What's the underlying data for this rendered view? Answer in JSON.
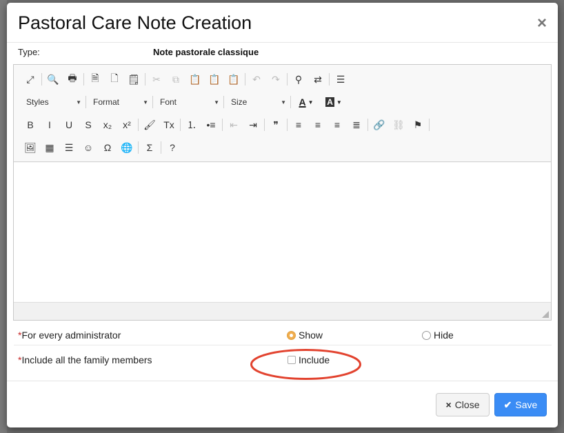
{
  "modal": {
    "title": "Pastoral Care Note Creation",
    "close_glyph": "×"
  },
  "type_row": {
    "label": "Type:",
    "value": "Note pastorale classique"
  },
  "editor": {
    "toolbar": {
      "row1": [
        {
          "icon": "maximize-icon",
          "glyph": "⤢"
        },
        {
          "sep": true
        },
        {
          "icon": "preview-icon",
          "glyph": "🔍"
        },
        {
          "icon": "print-icon",
          "glyph": "🖶"
        },
        {
          "sep": true
        },
        {
          "icon": "templates-icon",
          "glyph": "🗎"
        },
        {
          "icon": "new-page-icon",
          "glyph": "🗋"
        },
        {
          "icon": "source-icon",
          "glyph": "🗒"
        },
        {
          "sep": true
        },
        {
          "icon": "cut-icon",
          "glyph": "✂",
          "disabled": true
        },
        {
          "icon": "copy-icon",
          "glyph": "⧉",
          "disabled": true
        },
        {
          "icon": "paste-icon",
          "glyph": "📋"
        },
        {
          "icon": "paste-text-icon",
          "glyph": "📋"
        },
        {
          "icon": "paste-word-icon",
          "glyph": "📋"
        },
        {
          "sep": true
        },
        {
          "icon": "undo-icon",
          "glyph": "↶",
          "disabled": true
        },
        {
          "icon": "redo-icon",
          "glyph": "↷",
          "disabled": true
        },
        {
          "sep": true
        },
        {
          "icon": "find-icon",
          "glyph": "⚲"
        },
        {
          "icon": "replace-icon",
          "glyph": "⇄"
        },
        {
          "sep": true
        },
        {
          "icon": "select-all-icon",
          "glyph": "☰"
        }
      ],
      "combos": [
        {
          "label": "Styles",
          "width": 92
        },
        {
          "label": "Format",
          "width": 92
        },
        {
          "label": "Font",
          "width": 98
        },
        {
          "label": "Size",
          "width": 92
        }
      ],
      "text_color_glyph": "A",
      "bg_color_glyph": "A",
      "row3": [
        {
          "icon": "bold-icon",
          "glyph": "B"
        },
        {
          "icon": "italic-icon",
          "glyph": "I"
        },
        {
          "icon": "underline-icon",
          "glyph": "U"
        },
        {
          "icon": "strike-icon",
          "glyph": "S"
        },
        {
          "icon": "subscript-icon",
          "glyph": "x₂"
        },
        {
          "icon": "superscript-icon",
          "glyph": "x²"
        },
        {
          "sep": true
        },
        {
          "icon": "copy-format-icon",
          "glyph": "🖌"
        },
        {
          "icon": "remove-format-icon",
          "glyph": "Tx"
        },
        {
          "sep": true
        },
        {
          "icon": "numbered-list-icon",
          "glyph": "⒈"
        },
        {
          "icon": "bulleted-list-icon",
          "glyph": "•≡"
        },
        {
          "sep": true
        },
        {
          "icon": "outdent-icon",
          "glyph": "⇤",
          "disabled": true
        },
        {
          "icon": "indent-icon",
          "glyph": "⇥"
        },
        {
          "sep": true
        },
        {
          "icon": "blockquote-icon",
          "glyph": "❞"
        },
        {
          "sep": true
        },
        {
          "icon": "align-left-icon",
          "glyph": "≡"
        },
        {
          "icon": "align-center-icon",
          "glyph": "≡"
        },
        {
          "icon": "align-right-icon",
          "glyph": "≡"
        },
        {
          "icon": "justify-icon",
          "glyph": "≣"
        },
        {
          "sep": true
        },
        {
          "icon": "link-icon",
          "glyph": "🔗"
        },
        {
          "icon": "unlink-icon",
          "glyph": "⛓",
          "disabled": true
        },
        {
          "icon": "anchor-icon",
          "glyph": "⚑"
        },
        {
          "sep": true
        }
      ],
      "row4": [
        {
          "icon": "image-icon",
          "glyph": "🖼"
        },
        {
          "icon": "table-icon",
          "glyph": "▦"
        },
        {
          "icon": "horizontal-line-icon",
          "glyph": "☰"
        },
        {
          "icon": "smiley-icon",
          "glyph": "☺"
        },
        {
          "icon": "special-char-icon",
          "glyph": "Ω"
        },
        {
          "icon": "iframe-icon",
          "glyph": "🌐"
        },
        {
          "sep": true
        },
        {
          "icon": "math-icon",
          "glyph": "Σ"
        },
        {
          "sep": true
        },
        {
          "icon": "help-icon",
          "glyph": "?"
        }
      ]
    },
    "content": ""
  },
  "fields": {
    "administrator": {
      "required_mark": "*",
      "label": "For every administrator",
      "options": [
        {
          "label": "Show",
          "checked": true
        },
        {
          "label": "Hide",
          "checked": false
        }
      ]
    },
    "family": {
      "required_mark": "*",
      "label": "Include all the family members",
      "checkbox_label": "Include",
      "checked": false
    }
  },
  "annotation": {
    "color": "#e2432f"
  },
  "footer": {
    "close_label": "Close",
    "close_icon": "×",
    "save_label": "Save",
    "save_icon": "✔"
  },
  "colors": {
    "primary": "#3a8cf5",
    "radio_checked": "#f0ad4e",
    "required": "#c62828"
  }
}
